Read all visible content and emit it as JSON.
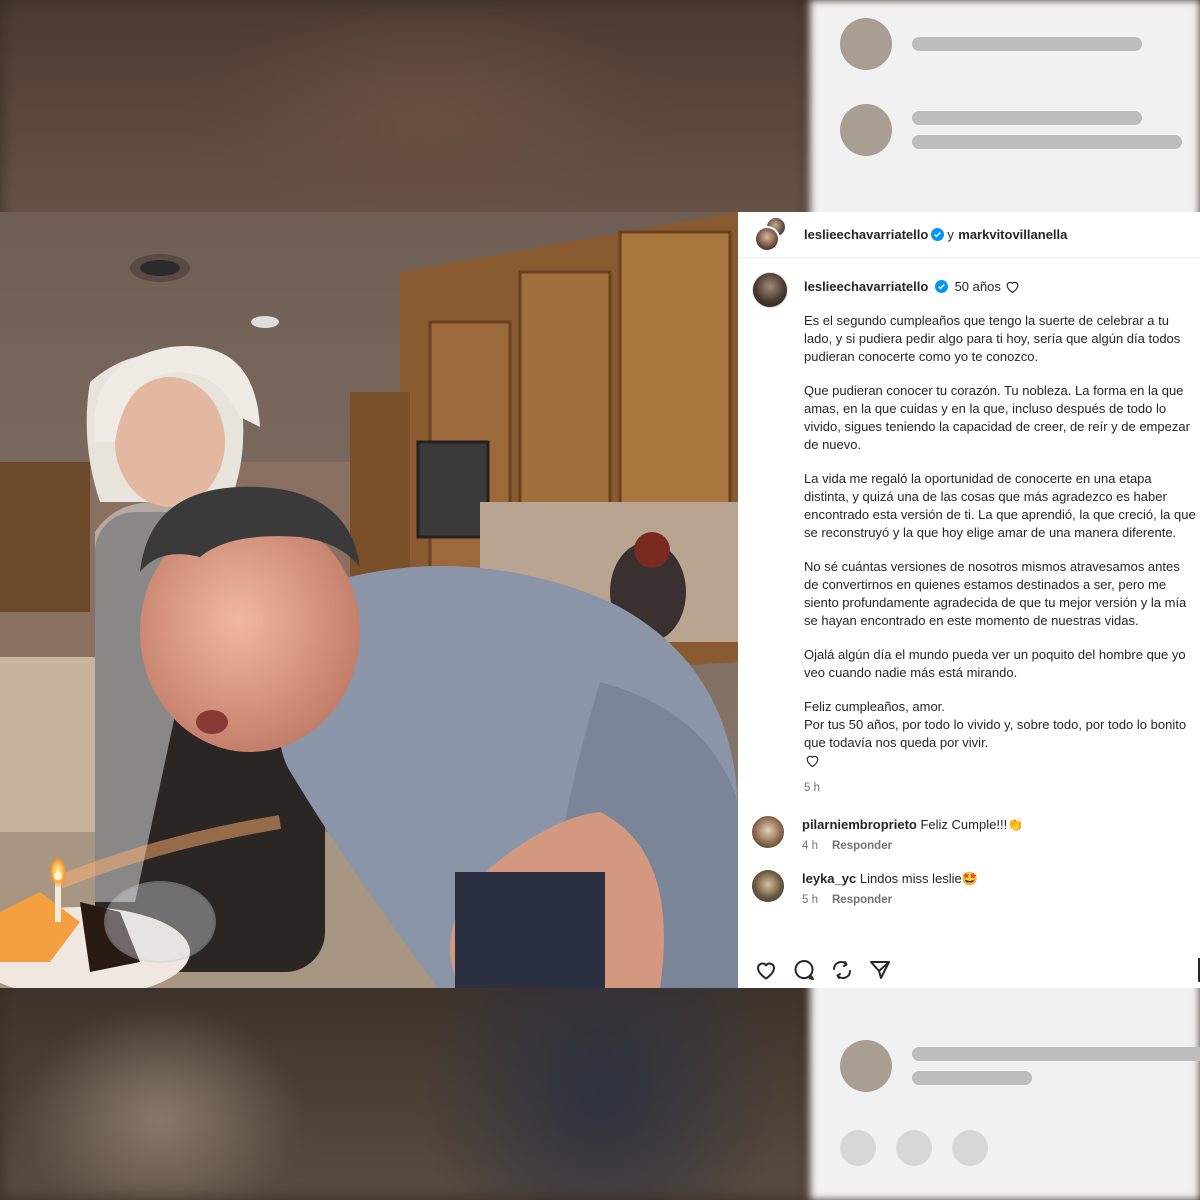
{
  "post": {
    "header": {
      "author": "leslieechavarriatello",
      "conjunction": "y",
      "collaborator": "markvitovillanella"
    },
    "caption": {
      "author": "leslieechavarriatello",
      "headline": "50 años",
      "paragraphs": [
        "Es el segundo cumpleaños que tengo la suerte de celebrar a tu lado, y si pudiera pedir algo para ti hoy, sería que algún día todos pudieran conocerte como yo te conozco.",
        "Que pudieran conocer tu corazón. Tu nobleza. La forma en la que amas, en la que cuidas y en la que, incluso después de todo lo vivido, sigues teniendo la capacidad de creer, de reír y de empezar de nuevo.",
        "La vida me regaló la oportunidad de conocerte en una etapa distinta, y quizá una de las cosas que más agradezco es haber encontrado esta versión de ti. La que aprendió, la que creció, la que se reconstruyó y la que hoy elige amar de una manera diferente.",
        "No sé cuántas versiones de nosotros mismos atravesamos antes de convertirnos en quienes estamos destinados a ser, pero me siento profundamente agradecida de que tu mejor versión y la mía se hayan encontrado en este momento de nuestras vidas.",
        "Ojalá algún día el mundo pueda ver un poquito del hombre que yo veo cuando nadie más está mirando.",
        "Feliz cumpleaños, amor.\nPor tus 50 años, por todo lo vivido y, sobre todo, por todo lo bonito que todavía nos queda por vivir."
      ],
      "time": "5 h"
    },
    "comments": [
      {
        "user": "pilarniembroprieto",
        "text": "Feliz Cumple!!!👏",
        "time": "4 h",
        "reply": "Responder"
      },
      {
        "user": "leyka_yc",
        "text": "Lindos miss leslie🤩",
        "time": "5 h",
        "reply": "Responder"
      }
    ],
    "actions": [
      "heart-icon",
      "comment-icon",
      "share-icon",
      "send-icon",
      "bookmark-icon"
    ]
  },
  "colors": {
    "verified": "#0095f6",
    "text": "#262626",
    "muted": "#737373"
  }
}
